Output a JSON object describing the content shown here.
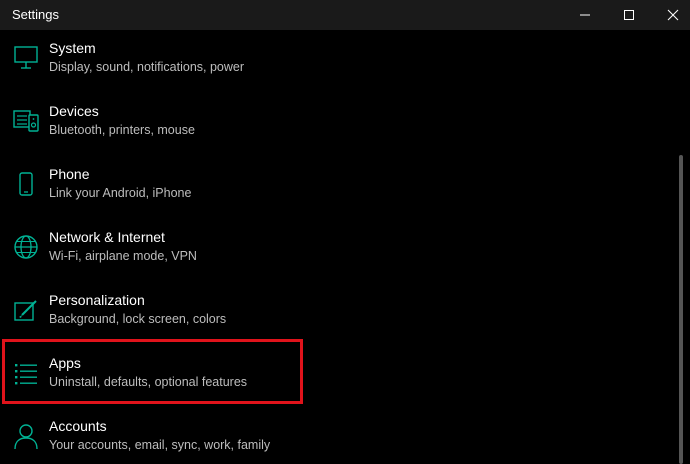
{
  "window": {
    "title": "Settings",
    "accent_color": "#00b294"
  },
  "items": [
    {
      "label": "System",
      "description": "Display, sound, notifications, power",
      "icon": "monitor-icon"
    },
    {
      "label": "Devices",
      "description": "Bluetooth, printers, mouse",
      "icon": "devices-icon"
    },
    {
      "label": "Phone",
      "description": "Link your Android, iPhone",
      "icon": "phone-icon"
    },
    {
      "label": "Network & Internet",
      "description": "Wi-Fi, airplane mode, VPN",
      "icon": "globe-icon"
    },
    {
      "label": "Personalization",
      "description": "Background, lock screen, colors",
      "icon": "paintbrush-icon"
    },
    {
      "label": "Apps",
      "description": "Uninstall, defaults, optional features",
      "icon": "apps-list-icon"
    },
    {
      "label": "Accounts",
      "description": "Your accounts, email, sync, work, family",
      "icon": "person-icon"
    }
  ],
  "highlighted_item": "Apps",
  "highlight_color": "#e0131b"
}
